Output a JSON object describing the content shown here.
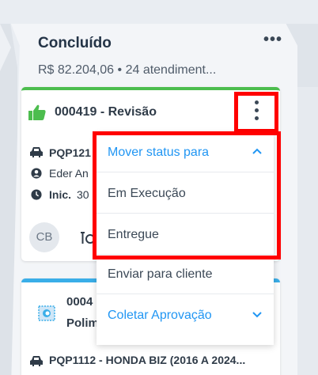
{
  "column": {
    "title": "Concluído",
    "subtitle": "R$ 82.204,06 • 24 atendiment...",
    "more_label": "•••"
  },
  "card1": {
    "id_title": "000419 - Revisão",
    "vehicle": "PQP121",
    "customer": "Eder An",
    "inic_label": "Inic.",
    "inic_value": "30",
    "avatar_initials": "CB",
    "accent_color": "#4cbd4e"
  },
  "card2": {
    "id_title": "0004",
    "name": "Polim",
    "vehicle": "PQP1112 - HONDA BIZ (2016 A 2024...",
    "accent_color": "#3aaee8"
  },
  "menu": {
    "header": "Mover status para",
    "items": [
      "Em Execução",
      "Entregue",
      "Enviar para cliente",
      "Coletar Aprovação"
    ],
    "accent_color": "#2196f3"
  }
}
